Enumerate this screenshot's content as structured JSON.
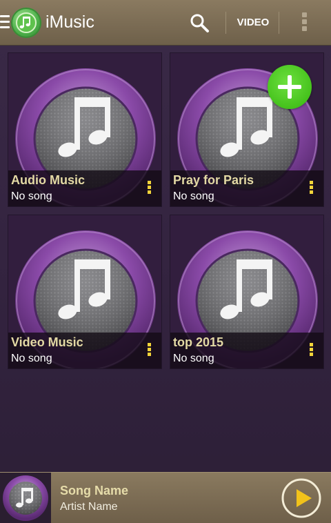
{
  "app": {
    "title": "iMusic"
  },
  "toolbar": {
    "video_label": "VIDEO"
  },
  "playlists": [
    {
      "title": "Audio Music",
      "subtitle": "No song"
    },
    {
      "title": "Pray for Paris",
      "subtitle": "No song"
    },
    {
      "title": "Video Music",
      "subtitle": "No song"
    },
    {
      "title": "top 2015",
      "subtitle": "No song"
    }
  ],
  "player": {
    "song_name": "Song Name",
    "artist_name": "Artist Name"
  },
  "colors": {
    "accent_yellow": "#f2d43a",
    "add_green": "#45c21c",
    "disc_purple": "#8a4aa8"
  },
  "icons": {
    "menu": "menu-icon",
    "logo": "music-note-logo-icon",
    "search": "search-icon",
    "overflow": "overflow-menu-icon",
    "add": "plus-icon",
    "play": "play-icon",
    "artwork": "music-note-disc-icon"
  }
}
